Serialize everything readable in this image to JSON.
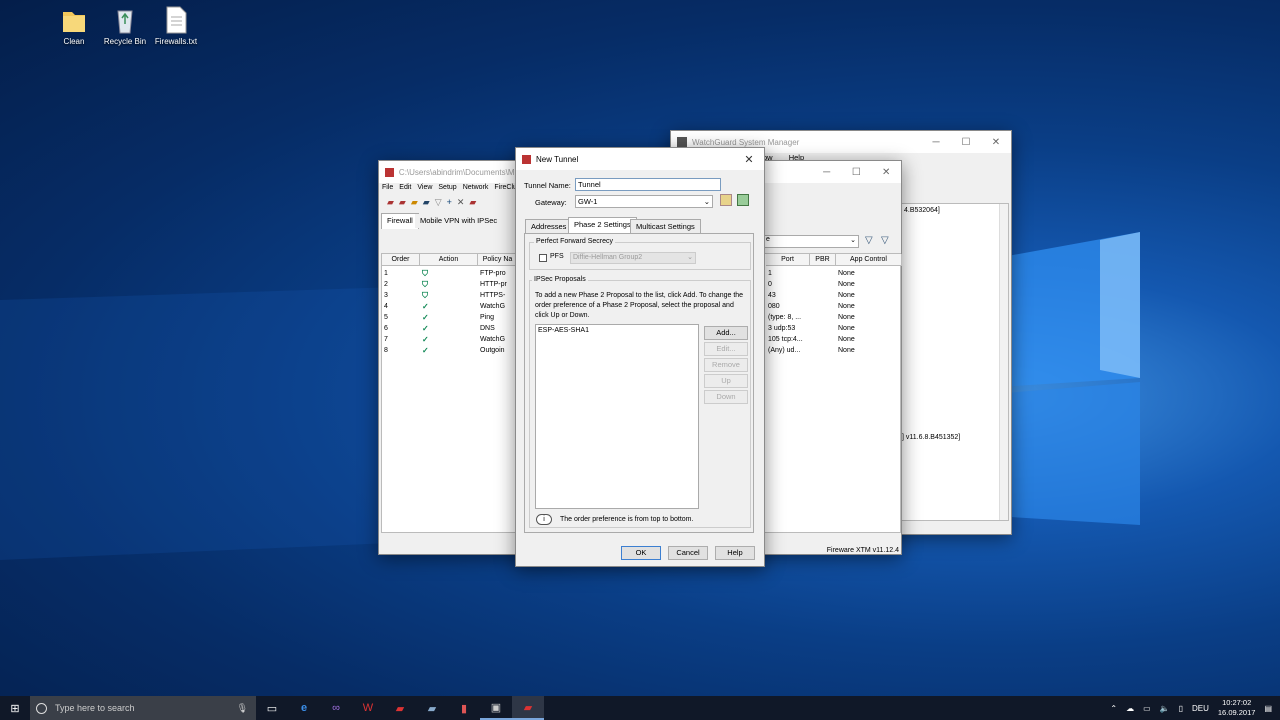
{
  "desktop": {
    "icons": [
      {
        "label": "Clean",
        "icon": "folder-icon"
      },
      {
        "label": "Recycle Bin",
        "icon": "recycle-bin-icon"
      },
      {
        "label": "Firewalls.txt",
        "icon": "text-file-icon"
      }
    ]
  },
  "wsm": {
    "title": "WatchGuard System Manager",
    "menu_frag1": "ow",
    "menu_frag2": "Help",
    "row1": "4.B532064]",
    "row2": "] v11.6.8.B451352]"
  },
  "pm": {
    "title": "C:\\Users\\abindrim\\Documents\\M",
    "menu": [
      "File",
      "Edit",
      "View",
      "Setup",
      "Network",
      "FireClu"
    ],
    "tabs": [
      "Firewall",
      "Mobile VPN with IPSec"
    ],
    "headers": [
      "Order",
      "Action",
      "Policy Na",
      "Port",
      "PBR",
      "App Control"
    ],
    "filter_value": "e",
    "rows": [
      {
        "order": "1",
        "name": "FTP-pro",
        "port": "1",
        "pbr": "None"
      },
      {
        "order": "2",
        "name": "HTTP-pr",
        "port": "0",
        "pbr": "None"
      },
      {
        "order": "3",
        "name": "HTTPS-",
        "port": "43",
        "pbr": "None"
      },
      {
        "order": "4",
        "name": "WatchG",
        "port": "080",
        "pbr": "None"
      },
      {
        "order": "5",
        "name": "Ping",
        "port": "(type: 8, ...",
        "pbr": "None"
      },
      {
        "order": "6",
        "name": "DNS",
        "port": "3 udp:53",
        "pbr": "None"
      },
      {
        "order": "7",
        "name": "WatchG",
        "port": "105 tcp:4...",
        "pbr": "None"
      },
      {
        "order": "8",
        "name": "Outgoin",
        "port": "(Any) ud...",
        "pbr": "None"
      }
    ],
    "status": "Fireware XTM v11.12.4"
  },
  "dialog": {
    "title": "New Tunnel",
    "tunnel_name_label": "Tunnel Name:",
    "tunnel_name_value": "Tunnel",
    "gateway_label": "Gateway:",
    "gateway_value": "GW-1",
    "tabs": [
      "Addresses",
      "Phase 2 Settings",
      "Multicast Settings"
    ],
    "pfs_group_label": "Perfect Forward Secrecy",
    "pfs_label": "PFS",
    "dh_value": "Diffie-Hellman Group2",
    "ipsec_group_label": "IPSec Proposals",
    "ipsec_desc": "To add a new Phase 2 Proposal to the list, click Add. To change the order preference of a Phase 2 Proposal, select the proposal and click Up or Down.",
    "proposals": [
      "ESP-AES-SHA1"
    ],
    "buttons": {
      "add": "Add...",
      "edit": "Edit...",
      "remove": "Remove",
      "up": "Up",
      "down": "Down"
    },
    "info": "The order preference is from top to bottom.",
    "ok": "OK",
    "cancel": "Cancel",
    "help": "Help"
  },
  "taskbar": {
    "search_placeholder": "Type here to search",
    "lang": "DEU",
    "time": "10:27:02",
    "date": "16.09.2017"
  }
}
